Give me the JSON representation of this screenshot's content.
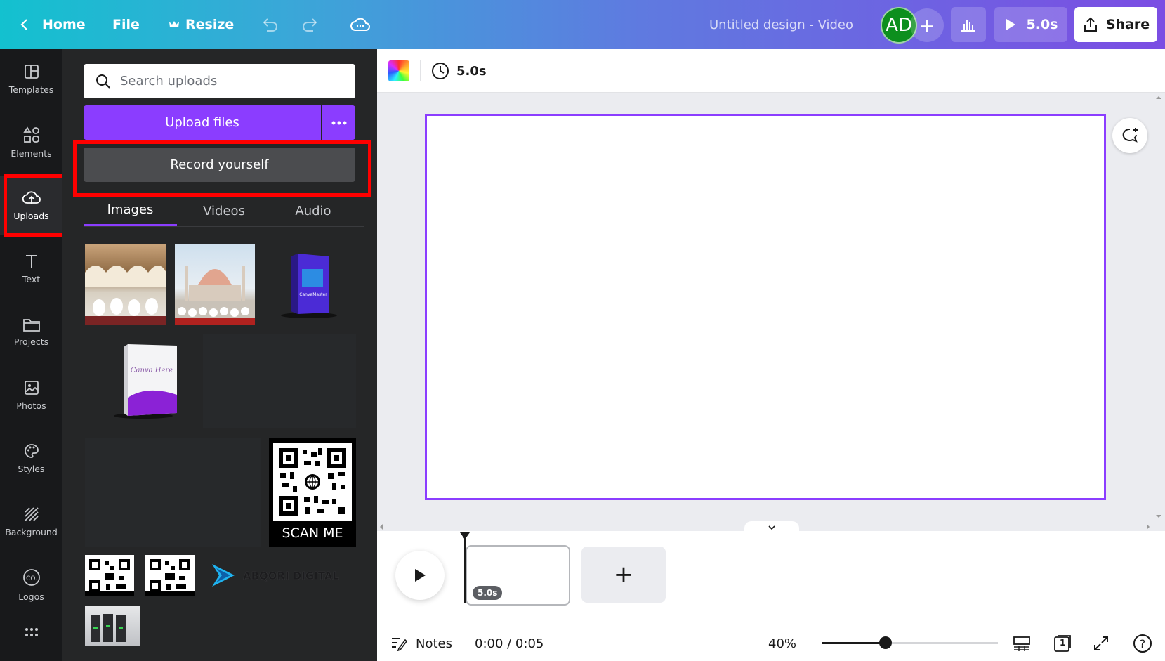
{
  "topbar": {
    "home_label": "Home",
    "file_label": "File",
    "resize_label": "Resize",
    "design_title": "Untitled design - Video",
    "avatar_initials": "AD",
    "avatar_add": "+",
    "play_duration": "5.0s",
    "share_label": "Share"
  },
  "rail": {
    "items": [
      {
        "label": "Templates",
        "icon": "templates-icon"
      },
      {
        "label": "Elements",
        "icon": "elements-icon"
      },
      {
        "label": "Uploads",
        "icon": "upload-cloud-icon"
      },
      {
        "label": "Text",
        "icon": "text-icon"
      },
      {
        "label": "Projects",
        "icon": "folder-icon"
      },
      {
        "label": "Photos",
        "icon": "photo-icon"
      },
      {
        "label": "Styles",
        "icon": "palette-icon"
      },
      {
        "label": "Background",
        "icon": "background-icon"
      },
      {
        "label": "Logos",
        "icon": "logo-icon"
      }
    ],
    "active": "Uploads"
  },
  "panel": {
    "search_placeholder": "Search uploads",
    "upload_label": "Upload files",
    "record_label": "Record yourself",
    "tabs": [
      "Images",
      "Videos",
      "Audio"
    ],
    "active_tab": "Images",
    "qr_caption": "SCAN ME",
    "logo_text": "ABQORI DIGITAL",
    "box_brand": "Canva Here"
  },
  "toolbar": {
    "duration": "5.0s"
  },
  "timeline": {
    "clip_duration": "5.0s",
    "add_page": "+"
  },
  "footer": {
    "notes_label": "Notes",
    "time": "0:00 / 0:05",
    "zoom": "40%",
    "zoom_level_fraction": 0.36,
    "page_count": "1",
    "help": "?"
  },
  "colors": {
    "accent": "#8b3dff",
    "highlight_box": "#ff0000",
    "rail_bg": "#18191b",
    "panel_bg": "#252627"
  }
}
